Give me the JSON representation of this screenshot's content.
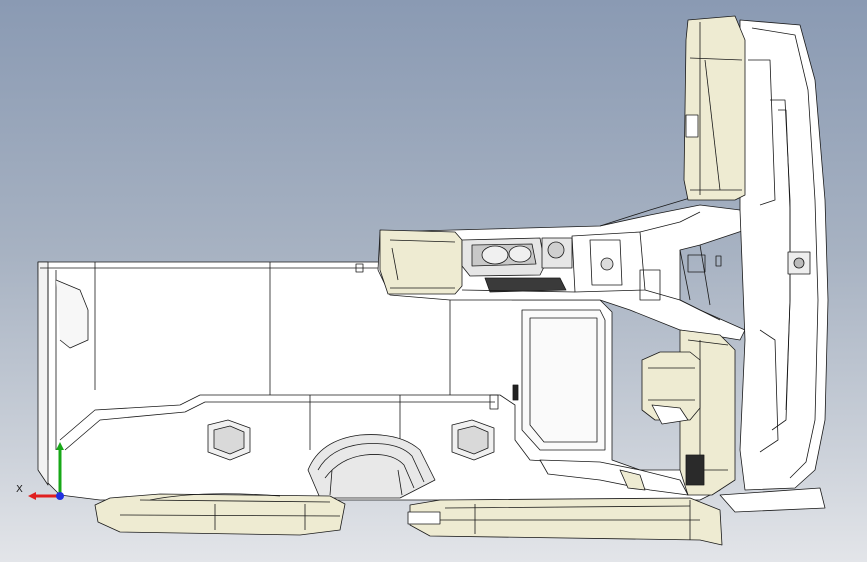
{
  "viewport": {
    "background_top": "#8a9ab3",
    "background_bottom": "#e3e5e9"
  },
  "triad": {
    "x_label": "X",
    "x_color": "#e02020",
    "y_color": "#18a818",
    "z_color": "#2030e0"
  },
  "model": {
    "line_color": "#1a1a1a",
    "body_fill": "#ffffff",
    "cream_fill": "#eeebd2",
    "shade_fill": "#d9d9d9"
  }
}
